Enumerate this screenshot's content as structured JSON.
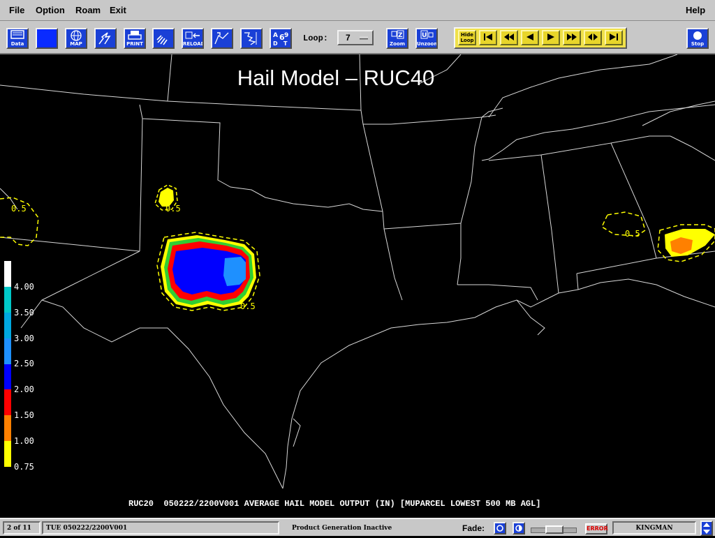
{
  "menubar": {
    "items": [
      "File",
      "Option",
      "Roam",
      "Exit"
    ],
    "help": "Help"
  },
  "toolbar": {
    "data_label": "Data",
    "map_label": "MAP",
    "print_label": "PRINT",
    "reload_label": "RELOAD",
    "loop_label": "Loop:",
    "loop_value": "7",
    "zoom_label": "Zoom",
    "unzoom_label": "Unzoom",
    "hide_loop_label": "Hide Loop",
    "stop_label": "Stop"
  },
  "map": {
    "title": "Hail Model – RUC40",
    "contour_label": "0.5",
    "caption": "RUC20  050222/2200V001 AVERAGE HAIL MODEL OUTPUT (IN) [MUPARCEL LOWEST 500 MB AGL]",
    "legend": {
      "labels": [
        "4.00",
        "3.50",
        "3.00",
        "2.50",
        "2.00",
        "1.50",
        "1.00",
        "0.75"
      ],
      "colors": [
        "#ffffff",
        "#00c8c8",
        "#00a8e0",
        "#1e90ff",
        "#0000ff",
        "#ff0000",
        "#ff8000",
        "#ffff00",
        "#000000"
      ]
    },
    "colors": {
      "yellow": "#ffff00",
      "orange": "#ff8000",
      "red": "#ff0000",
      "green": "#32cd32",
      "blue": "#0000ff",
      "lightblue": "#1e90ff"
    }
  },
  "status": {
    "frame": "2 of 11",
    "datetime": "TUE 050222/2200V001",
    "product_status": "Product Generation Inactive",
    "fade_label": "Fade:",
    "error_label": "ERROR",
    "site": "KINGMAN"
  }
}
